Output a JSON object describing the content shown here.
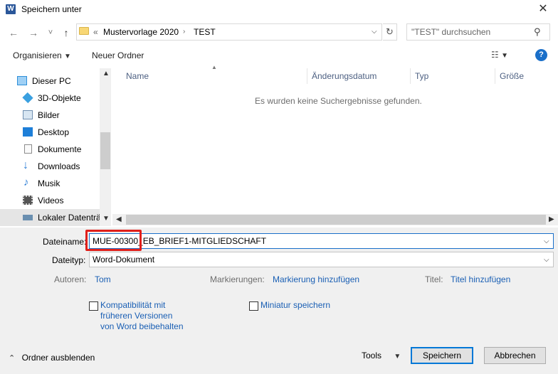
{
  "window": {
    "title": "Speichern unter",
    "app_icon_letter": "W"
  },
  "nav": {
    "back": "←",
    "forward": "→",
    "recent": "˅",
    "up": "↑",
    "breadcrumb_prefix": "«",
    "crumbs": [
      "Mustervorlage 2020",
      "TEST"
    ],
    "search_placeholder": "\"TEST\" durchsuchen"
  },
  "toolbar": {
    "organize": "Organisieren",
    "new_folder": "Neuer Ordner",
    "help": "?"
  },
  "sidebar": {
    "items": [
      {
        "label": "Dieser PC",
        "icon": "pc-icon",
        "color": "#2f8fd8"
      },
      {
        "label": "3D-Objekte",
        "icon": "cube-icon",
        "color": "#3aa0e0"
      },
      {
        "label": "Bilder",
        "icon": "pictures-icon",
        "color": "#6f8fb0"
      },
      {
        "label": "Desktop",
        "icon": "desktop-icon",
        "color": "#1e7fd8"
      },
      {
        "label": "Dokumente",
        "icon": "documents-icon",
        "color": "#8c8c8c"
      },
      {
        "label": "Downloads",
        "icon": "download-icon",
        "color": "#2f7fd6"
      },
      {
        "label": "Musik",
        "icon": "music-icon",
        "color": "#2f7fd6"
      },
      {
        "label": "Videos",
        "icon": "video-icon",
        "color": "#555555"
      },
      {
        "label": "Lokaler Datenträ",
        "icon": "drive-icon",
        "color": "#6a8fb0"
      }
    ]
  },
  "file_list": {
    "columns": [
      "Name",
      "Änderungsdatum",
      "Typ",
      "Größe"
    ],
    "empty_message": "Es wurden keine Suchergebnisse gefunden."
  },
  "form": {
    "filename_label": "Dateiname:",
    "filename_value": "MUE-00300_EB_BRIEF1-MITGLIEDSCHAFT",
    "filetype_label": "Dateityp:",
    "filetype_value": "Word-Dokument",
    "authors_label": "Autoren:",
    "authors_value": "Tom",
    "tags_label": "Markierungen:",
    "tags_value": "Markierung hinzufügen",
    "title_label": "Titel:",
    "title_value": "Titel hinzufügen",
    "compat_line1": "Kompatibilität mit",
    "compat_line2": "früheren Versionen",
    "compat_line3": "von Word beibehalten",
    "thumbnail_label": "Miniatur speichern"
  },
  "footer": {
    "hide_folders": "Ordner ausblenden",
    "tools": "Tools",
    "save": "Speichern",
    "cancel": "Abbrechen"
  },
  "colors": {
    "accent": "#0078d7",
    "link": "#1a5fb4",
    "highlight": "#e0201b"
  }
}
